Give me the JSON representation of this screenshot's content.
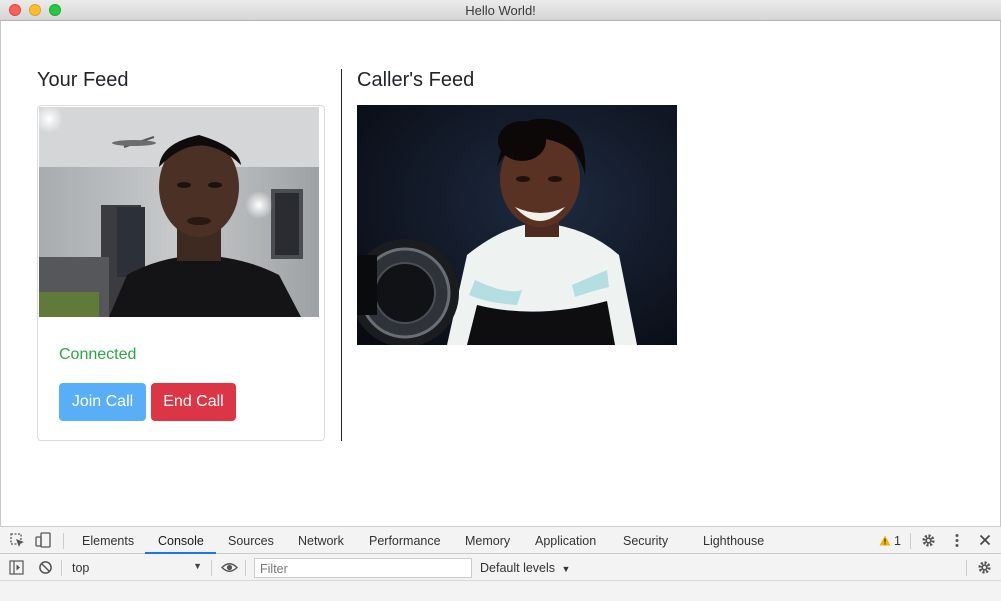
{
  "window": {
    "title": "Hello World!"
  },
  "local": {
    "heading": "Your Feed",
    "status": "Connected",
    "join_label": "Join Call",
    "end_label": "End Call"
  },
  "remote": {
    "heading": "Caller's Feed"
  },
  "devtools": {
    "tabs": [
      "Elements",
      "Console",
      "Sources",
      "Network",
      "Performance",
      "Memory",
      "Application",
      "Security",
      "Lighthouse"
    ],
    "active_tab": "Console",
    "warning_count": "1",
    "context": "top",
    "filter_placeholder": "Filter",
    "levels_label": "Default levels"
  },
  "colors": {
    "connected": "#28a745",
    "join": "#58aef7",
    "end": "#dc3545",
    "active_tab_underline": "#1a73e8"
  }
}
